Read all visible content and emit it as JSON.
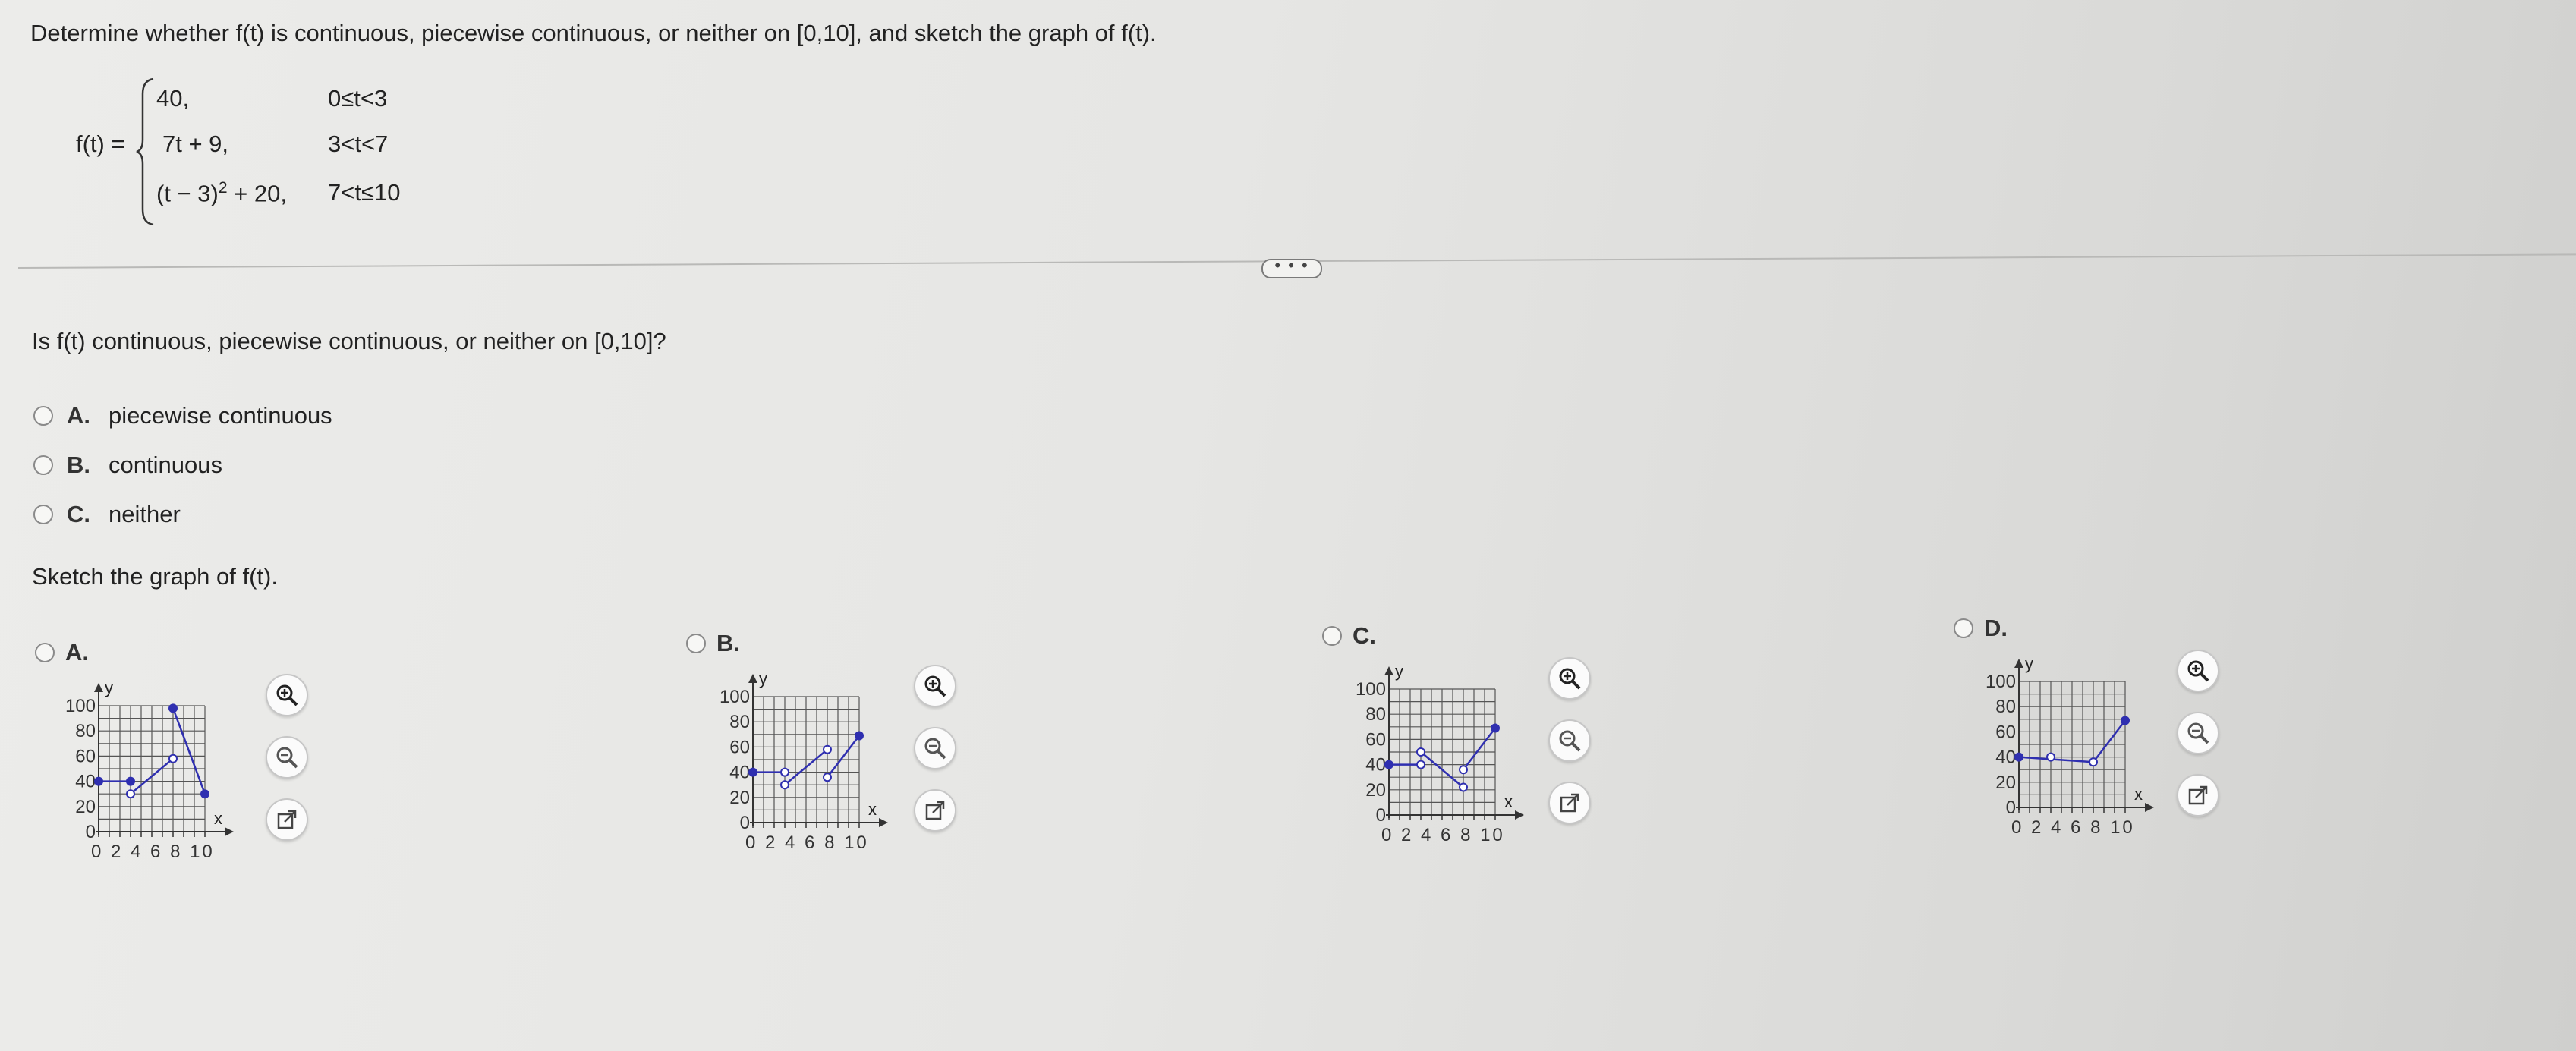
{
  "question": "Determine whether f(t) is continuous, piecewise continuous, or neither on [0,10], and sketch the graph of f(t).",
  "function": {
    "lhs": "f(t) =",
    "pieces": [
      {
        "expr": "40,",
        "cond": "0≤t<3"
      },
      {
        "expr": "7t + 9,",
        "cond": "3<t<7"
      },
      {
        "expr_base": "(t − 3)",
        "expr_exp": "2",
        "expr_tail": " + 20,",
        "cond": "7<t≤10"
      }
    ]
  },
  "divider_button": "• • •",
  "sub_question": "Is f(t) continuous, piecewise continuous, or neither on [0,10]?",
  "choices": [
    {
      "letter": "A.",
      "text": "piecewise continuous"
    },
    {
      "letter": "B.",
      "text": "continuous"
    },
    {
      "letter": "C.",
      "text": "neither"
    }
  ],
  "sketch_prompt": "Sketch the graph of f(t).",
  "graph_options": [
    {
      "letter": "A.",
      "ylabel": "y",
      "xlabel": "x",
      "yticks": [
        "100",
        "80",
        "60",
        "40",
        "20",
        "0"
      ],
      "xticks": "0 2 4 6 8 10",
      "marks": [
        [
          0,
          40,
          "f"
        ],
        [
          3,
          40,
          "f"
        ],
        [
          3,
          30,
          "o"
        ],
        [
          7,
          58,
          "o"
        ],
        [
          7,
          98,
          "f"
        ],
        [
          10,
          30,
          "f"
        ]
      ],
      "segs": [
        [
          [
            0,
            40
          ],
          [
            3,
            40
          ]
        ],
        [
          [
            3,
            30
          ],
          [
            7,
            58
          ]
        ],
        [
          [
            7,
            98
          ],
          [
            10,
            30
          ]
        ]
      ]
    },
    {
      "letter": "B.",
      "ylabel": "y",
      "xlabel": "x",
      "yticks": [
        "100",
        "80",
        "60",
        "40",
        "20",
        "0"
      ],
      "xticks": "0 2 4 6 8 10",
      "marks": [
        [
          0,
          40,
          "f"
        ],
        [
          3,
          40,
          "o"
        ],
        [
          3,
          30,
          "o"
        ],
        [
          7,
          58,
          "o"
        ],
        [
          7,
          36,
          "o"
        ],
        [
          10,
          69,
          "f"
        ]
      ],
      "segs": [
        [
          [
            0,
            40
          ],
          [
            3,
            40
          ]
        ],
        [
          [
            3,
            30
          ],
          [
            7,
            58
          ]
        ],
        [
          [
            7,
            36
          ],
          [
            10,
            69
          ]
        ]
      ]
    },
    {
      "letter": "C.",
      "ylabel": "y",
      "xlabel": "x",
      "yticks": [
        "100",
        "80",
        "60",
        "40",
        "20",
        "0"
      ],
      "xticks": "0 2 4 6 8 10",
      "marks": [
        [
          0,
          40,
          "f"
        ],
        [
          3,
          40,
          "o"
        ],
        [
          3,
          50,
          "o"
        ],
        [
          7,
          22,
          "o"
        ],
        [
          7,
          36,
          "o"
        ],
        [
          10,
          69,
          "f"
        ]
      ],
      "segs": [
        [
          [
            0,
            40
          ],
          [
            3,
            40
          ]
        ],
        [
          [
            3,
            50
          ],
          [
            7,
            22
          ]
        ],
        [
          [
            7,
            36
          ],
          [
            10,
            69
          ]
        ]
      ]
    },
    {
      "letter": "D.",
      "ylabel": "y",
      "xlabel": "x",
      "yticks": [
        "100",
        "80",
        "60",
        "40",
        "20",
        "0"
      ],
      "xticks": "0 2 4 6 8 10",
      "marks": [
        [
          0,
          40,
          "f"
        ],
        [
          3,
          40,
          "o"
        ],
        [
          7,
          36,
          "o"
        ],
        [
          10,
          69,
          "f"
        ]
      ],
      "segs": [
        [
          [
            0,
            40
          ],
          [
            7,
            36
          ]
        ],
        [
          [
            7,
            36
          ],
          [
            10,
            69
          ]
        ]
      ]
    }
  ],
  "colors": {
    "curve": "#2f2fb0",
    "grid": "#555555",
    "text": "#222222"
  }
}
